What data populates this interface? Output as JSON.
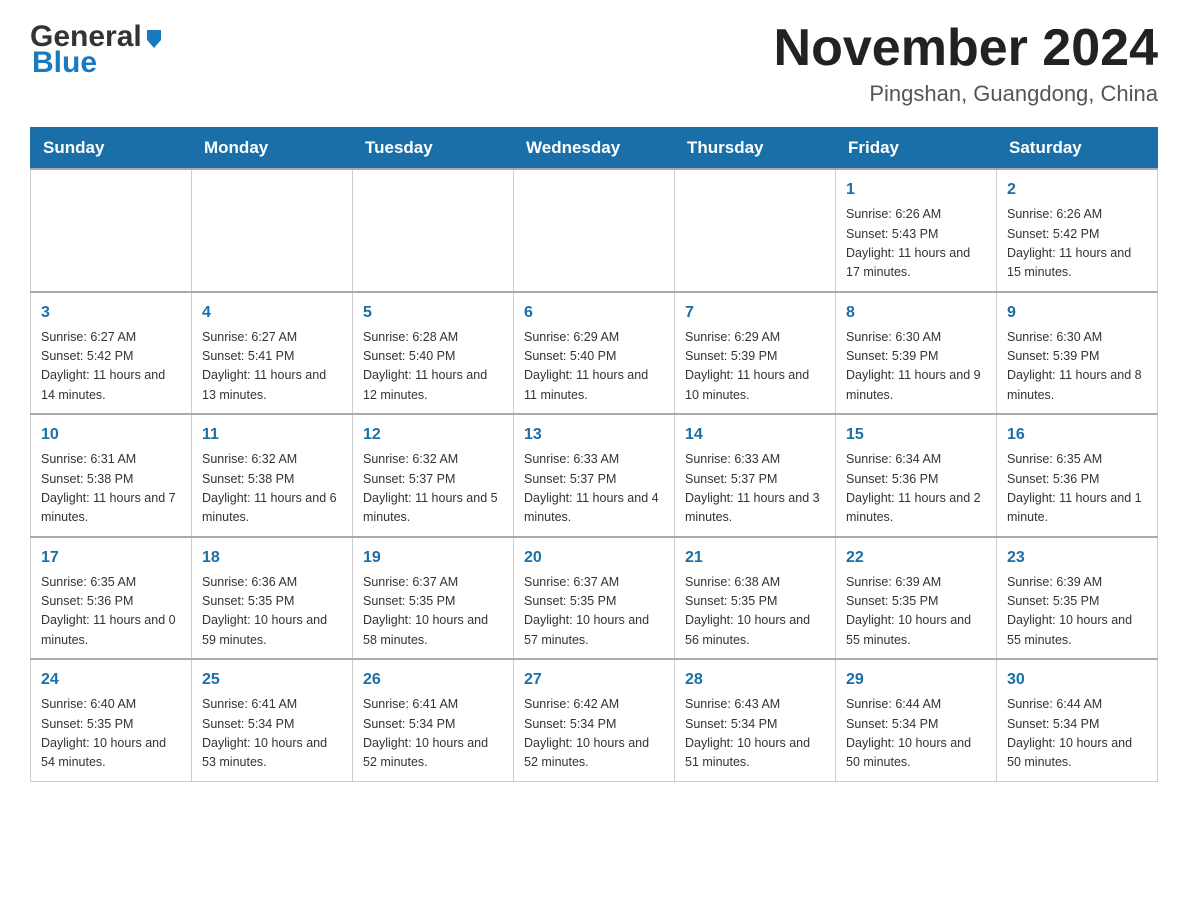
{
  "logo": {
    "general": "General",
    "blue": "Blue"
  },
  "header": {
    "title": "November 2024",
    "subtitle": "Pingshan, Guangdong, China"
  },
  "days_of_week": [
    "Sunday",
    "Monday",
    "Tuesday",
    "Wednesday",
    "Thursday",
    "Friday",
    "Saturday"
  ],
  "weeks": [
    [
      {
        "day": "",
        "info": ""
      },
      {
        "day": "",
        "info": ""
      },
      {
        "day": "",
        "info": ""
      },
      {
        "day": "",
        "info": ""
      },
      {
        "day": "",
        "info": ""
      },
      {
        "day": "1",
        "info": "Sunrise: 6:26 AM\nSunset: 5:43 PM\nDaylight: 11 hours and 17 minutes."
      },
      {
        "day": "2",
        "info": "Sunrise: 6:26 AM\nSunset: 5:42 PM\nDaylight: 11 hours and 15 minutes."
      }
    ],
    [
      {
        "day": "3",
        "info": "Sunrise: 6:27 AM\nSunset: 5:42 PM\nDaylight: 11 hours and 14 minutes."
      },
      {
        "day": "4",
        "info": "Sunrise: 6:27 AM\nSunset: 5:41 PM\nDaylight: 11 hours and 13 minutes."
      },
      {
        "day": "5",
        "info": "Sunrise: 6:28 AM\nSunset: 5:40 PM\nDaylight: 11 hours and 12 minutes."
      },
      {
        "day": "6",
        "info": "Sunrise: 6:29 AM\nSunset: 5:40 PM\nDaylight: 11 hours and 11 minutes."
      },
      {
        "day": "7",
        "info": "Sunrise: 6:29 AM\nSunset: 5:39 PM\nDaylight: 11 hours and 10 minutes."
      },
      {
        "day": "8",
        "info": "Sunrise: 6:30 AM\nSunset: 5:39 PM\nDaylight: 11 hours and 9 minutes."
      },
      {
        "day": "9",
        "info": "Sunrise: 6:30 AM\nSunset: 5:39 PM\nDaylight: 11 hours and 8 minutes."
      }
    ],
    [
      {
        "day": "10",
        "info": "Sunrise: 6:31 AM\nSunset: 5:38 PM\nDaylight: 11 hours and 7 minutes."
      },
      {
        "day": "11",
        "info": "Sunrise: 6:32 AM\nSunset: 5:38 PM\nDaylight: 11 hours and 6 minutes."
      },
      {
        "day": "12",
        "info": "Sunrise: 6:32 AM\nSunset: 5:37 PM\nDaylight: 11 hours and 5 minutes."
      },
      {
        "day": "13",
        "info": "Sunrise: 6:33 AM\nSunset: 5:37 PM\nDaylight: 11 hours and 4 minutes."
      },
      {
        "day": "14",
        "info": "Sunrise: 6:33 AM\nSunset: 5:37 PM\nDaylight: 11 hours and 3 minutes."
      },
      {
        "day": "15",
        "info": "Sunrise: 6:34 AM\nSunset: 5:36 PM\nDaylight: 11 hours and 2 minutes."
      },
      {
        "day": "16",
        "info": "Sunrise: 6:35 AM\nSunset: 5:36 PM\nDaylight: 11 hours and 1 minute."
      }
    ],
    [
      {
        "day": "17",
        "info": "Sunrise: 6:35 AM\nSunset: 5:36 PM\nDaylight: 11 hours and 0 minutes."
      },
      {
        "day": "18",
        "info": "Sunrise: 6:36 AM\nSunset: 5:35 PM\nDaylight: 10 hours and 59 minutes."
      },
      {
        "day": "19",
        "info": "Sunrise: 6:37 AM\nSunset: 5:35 PM\nDaylight: 10 hours and 58 minutes."
      },
      {
        "day": "20",
        "info": "Sunrise: 6:37 AM\nSunset: 5:35 PM\nDaylight: 10 hours and 57 minutes."
      },
      {
        "day": "21",
        "info": "Sunrise: 6:38 AM\nSunset: 5:35 PM\nDaylight: 10 hours and 56 minutes."
      },
      {
        "day": "22",
        "info": "Sunrise: 6:39 AM\nSunset: 5:35 PM\nDaylight: 10 hours and 55 minutes."
      },
      {
        "day": "23",
        "info": "Sunrise: 6:39 AM\nSunset: 5:35 PM\nDaylight: 10 hours and 55 minutes."
      }
    ],
    [
      {
        "day": "24",
        "info": "Sunrise: 6:40 AM\nSunset: 5:35 PM\nDaylight: 10 hours and 54 minutes."
      },
      {
        "day": "25",
        "info": "Sunrise: 6:41 AM\nSunset: 5:34 PM\nDaylight: 10 hours and 53 minutes."
      },
      {
        "day": "26",
        "info": "Sunrise: 6:41 AM\nSunset: 5:34 PM\nDaylight: 10 hours and 52 minutes."
      },
      {
        "day": "27",
        "info": "Sunrise: 6:42 AM\nSunset: 5:34 PM\nDaylight: 10 hours and 52 minutes."
      },
      {
        "day": "28",
        "info": "Sunrise: 6:43 AM\nSunset: 5:34 PM\nDaylight: 10 hours and 51 minutes."
      },
      {
        "day": "29",
        "info": "Sunrise: 6:44 AM\nSunset: 5:34 PM\nDaylight: 10 hours and 50 minutes."
      },
      {
        "day": "30",
        "info": "Sunrise: 6:44 AM\nSunset: 5:34 PM\nDaylight: 10 hours and 50 minutes."
      }
    ]
  ]
}
